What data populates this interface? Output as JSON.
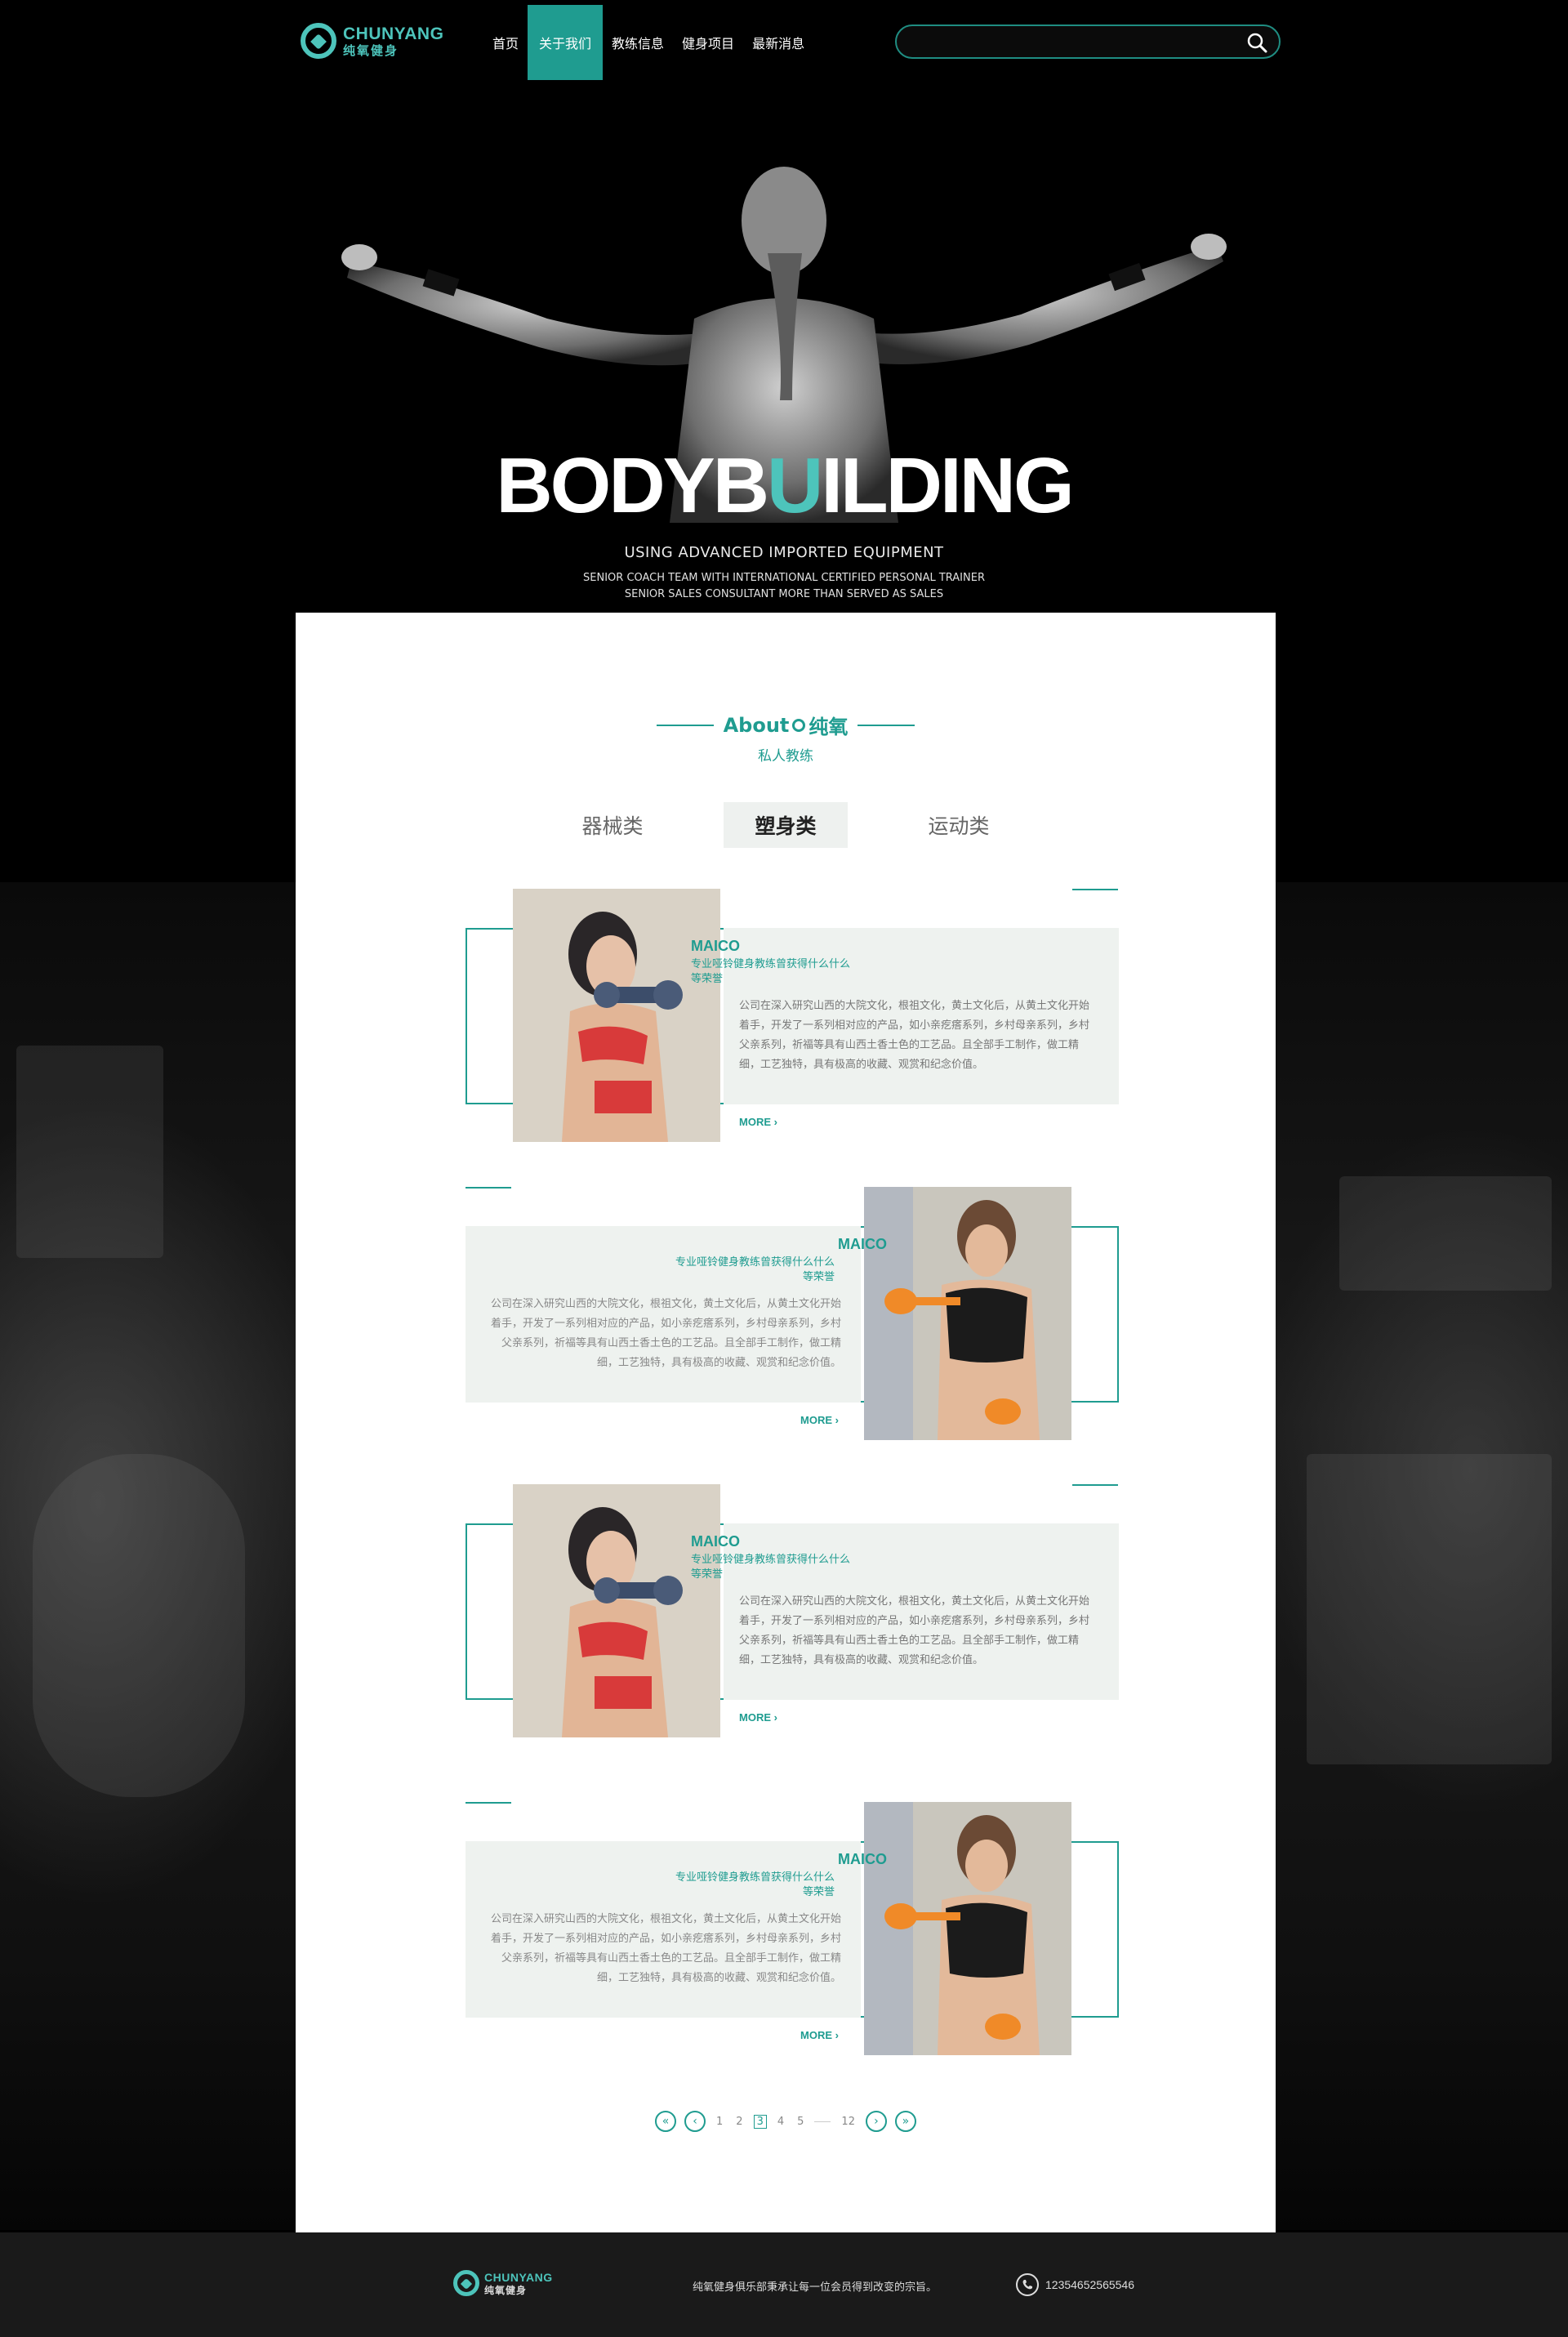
{
  "brand": {
    "name_en": "CHUNYANG",
    "name_cn": "纯氧健身"
  },
  "nav": {
    "items": [
      {
        "label": "首页"
      },
      {
        "label": "关于我们"
      },
      {
        "label": "教练信息"
      },
      {
        "label": "健身项目"
      },
      {
        "label": "最新消息"
      }
    ],
    "active_index": 1
  },
  "search": {
    "value": "",
    "placeholder": ""
  },
  "hero": {
    "title_pre": "BODYB",
    "title_highlight": "U",
    "title_post": "ILDING",
    "subtitle": "USING ADVANCED IMPORTED EQUIPMENT",
    "line1": "SENIOR COACH TEAM WITH INTERNATIONAL CERTIFIED PERSONAL TRAINER",
    "line2": "SENIOR SALES CONSULTANT MORE THAN SERVED AS SALES",
    "slides": 4,
    "active_slide": 3
  },
  "about": {
    "title_en": "About",
    "title_cn": "纯氧",
    "subtitle": "私人教练"
  },
  "tabs": [
    {
      "label": "器械类"
    },
    {
      "label": "塑身类"
    },
    {
      "label": "运动类"
    }
  ],
  "active_tab": 1,
  "coaches": [
    {
      "name": "MAICO",
      "title": "专业哑铃健身教练曾获得什么什么等荣誉",
      "description": "公司在深入研究山西的大院文化，根祖文化，黄土文化后，从黄土文化开始着手，开发了一系列相对应的产品，如小亲疙瘩系列，乡村母亲系列，乡村父亲系列，祈福等具有山西土香土色的工艺品。且全部手工制作，做工精细，工艺独特，具有极高的收藏、观赏和纪念价值。",
      "more_label": "MORE",
      "layout": "left",
      "photo": "woman-dumbbell-red"
    },
    {
      "name": "MAICO",
      "title": "专业哑铃健身教练曾获得什么什么等荣誉",
      "description": "公司在深入研究山西的大院文化，根祖文化，黄土文化后，从黄土文化开始着手，开发了一系列相对应的产品，如小亲疙瘩系列，乡村母亲系列，乡村父亲系列，祈福等具有山西土香土色的工艺品。且全部手工制作，做工精细，工艺独特，具有极高的收藏、观赏和纪念价值。",
      "more_label": "MORE",
      "layout": "right",
      "photo": "woman-dumbbell-black"
    },
    {
      "name": "MAICO",
      "title": "专业哑铃健身教练曾获得什么什么等荣誉",
      "description": "公司在深入研究山西的大院文化，根祖文化，黄土文化后，从黄土文化开始着手，开发了一系列相对应的产品，如小亲疙瘩系列，乡村母亲系列，乡村父亲系列，祈福等具有山西土香土色的工艺品。且全部手工制作，做工精细，工艺独特，具有极高的收藏、观赏和纪念价值。",
      "more_label": "MORE",
      "layout": "left",
      "photo": "woman-dumbbell-red"
    },
    {
      "name": "MAICO",
      "title": "专业哑铃健身教练曾获得什么什么等荣誉",
      "description": "公司在深入研究山西的大院文化，根祖文化，黄土文化后，从黄土文化开始着手，开发了一系列相对应的产品，如小亲疙瘩系列，乡村母亲系列，乡村父亲系列，祈福等具有山西土香土色的工艺品。且全部手工制作，做工精细，工艺独特，具有极高的收藏、观赏和纪念价值。",
      "more_label": "MORE",
      "layout": "right",
      "photo": "woman-dumbbell-black"
    }
  ],
  "pagination": {
    "first": "«",
    "prev": "‹",
    "pages": [
      "1",
      "2",
      "3",
      "4",
      "5"
    ],
    "last_page": "12",
    "current": "3",
    "next": "›",
    "last": "»"
  },
  "footer": {
    "brand_en": "CHUNYANG",
    "brand_cn": "纯氧健身",
    "slogan": "纯氧健身俱乐部秉承让每一位会员得到改变的宗旨。",
    "phone": "12354652565546"
  },
  "colors": {
    "accent": "#1f9c90",
    "accent_light": "#4dc4bb",
    "panel_bg": "#ffffff",
    "card_bg": "#eef2ef",
    "footer_bg": "#1a1a1a"
  }
}
